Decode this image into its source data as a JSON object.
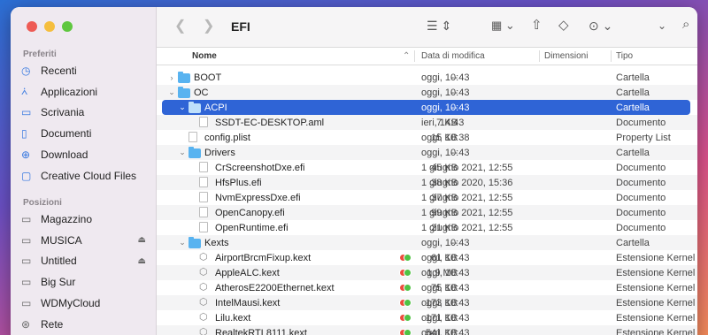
{
  "window": {
    "title": "EFI"
  },
  "traffic_lights": {
    "close": "#ee5b55",
    "minimize": "#f5be3e",
    "zoom": "#5fc73f"
  },
  "sidebar": {
    "favorites_title": "Preferiti",
    "favorites": [
      {
        "label": "Recenti",
        "icon": "clock-icon"
      },
      {
        "label": "Applicazioni",
        "icon": "apps-icon"
      },
      {
        "label": "Scrivania",
        "icon": "desktop-icon"
      },
      {
        "label": "Documenti",
        "icon": "document-icon"
      },
      {
        "label": "Download",
        "icon": "download-icon"
      },
      {
        "label": "Creative Cloud Files",
        "icon": "folder-icon"
      }
    ],
    "locations_title": "Posizioni",
    "locations": [
      {
        "label": "Magazzino",
        "icon": "drive-icon",
        "eject": false
      },
      {
        "label": "MUSICA",
        "icon": "drive-icon",
        "eject": true
      },
      {
        "label": "Untitled",
        "icon": "drive-icon",
        "eject": true
      },
      {
        "label": "Big Sur",
        "icon": "drive-icon",
        "eject": false
      },
      {
        "label": "WDMyCloud",
        "icon": "display-icon",
        "eject": false
      },
      {
        "label": "Rete",
        "icon": "globe-icon",
        "eject": false
      }
    ]
  },
  "toolbar": {
    "back_icon": "chevron-left-icon",
    "forward_icon": "chevron-right-icon",
    "list_view_icon": "list-view-icon",
    "group_icon": "grid-group-icon",
    "share_icon": "share-icon",
    "tag_icon": "tag-icon",
    "more_icon": "ellipsis-circle-icon",
    "search_icon": "search-icon"
  },
  "columns": {
    "name": "Nome",
    "date": "Data di modifica",
    "size": "Dimensioni",
    "kind": "Tipo"
  },
  "files": [
    {
      "name": "BOOT",
      "type": "folder",
      "level": 0,
      "open": false,
      "date": "oggi, 10:43",
      "size": "--",
      "kind": "Cartella"
    },
    {
      "name": "OC",
      "type": "folder",
      "level": 0,
      "open": true,
      "date": "oggi, 10:43",
      "size": "--",
      "kind": "Cartella"
    },
    {
      "name": "ACPI",
      "type": "folder",
      "level": 1,
      "open": true,
      "selected": true,
      "date": "oggi, 10:43",
      "size": "--",
      "kind": "Cartella"
    },
    {
      "name": "SSDT-EC-DESKTOP.aml",
      "type": "doc",
      "level": 2,
      "date": "ieri, 14:43",
      "size": "7 KB",
      "kind": "Documento"
    },
    {
      "name": "config.plist",
      "type": "doc",
      "level": 1,
      "date": "oggi, 10:38",
      "size": "15 KB",
      "kind": "Property List"
    },
    {
      "name": "Drivers",
      "type": "folder",
      "level": 1,
      "open": true,
      "date": "oggi, 10:43",
      "size": "--",
      "kind": "Cartella"
    },
    {
      "name": "CrScreenshotDxe.efi",
      "type": "doc",
      "level": 2,
      "date": "1 giugno 2021, 12:55",
      "size": "45 KB",
      "kind": "Documento"
    },
    {
      "name": "HfsPlus.efi",
      "type": "doc",
      "level": 2,
      "date": "1 giugno 2020, 15:36",
      "size": "38 KB",
      "kind": "Documento"
    },
    {
      "name": "NvmExpressDxe.efi",
      "type": "doc",
      "level": 2,
      "date": "1 giugno 2021, 12:55",
      "size": "37 KB",
      "kind": "Documento"
    },
    {
      "name": "OpenCanopy.efi",
      "type": "doc",
      "level": 2,
      "date": "1 giugno 2021, 12:55",
      "size": "99 KB",
      "kind": "Documento"
    },
    {
      "name": "OpenRuntime.efi",
      "type": "doc",
      "level": 2,
      "date": "1 giugno 2021, 12:55",
      "size": "21 KB",
      "kind": "Documento"
    },
    {
      "name": "Kexts",
      "type": "folder",
      "level": 1,
      "open": true,
      "date": "oggi, 10:43",
      "size": "--",
      "kind": "Cartella"
    },
    {
      "name": "AirportBrcmFixup.kext",
      "type": "kext",
      "level": 2,
      "tags": true,
      "date": "oggi, 10:43",
      "size": "61 KB",
      "kind": "Estensione Kernel"
    },
    {
      "name": "AppleALC.kext",
      "type": "kext",
      "level": 2,
      "tags": true,
      "date": "oggi, 10:43",
      "size": "1,9 MB",
      "kind": "Estensione Kernel"
    },
    {
      "name": "AtherosE2200Ethernet.kext",
      "type": "kext",
      "level": 2,
      "tags": true,
      "date": "oggi, 10:43",
      "size": "75 KB",
      "kind": "Estensione Kernel"
    },
    {
      "name": "IntelMausi.kext",
      "type": "kext",
      "level": 2,
      "tags": true,
      "date": "oggi, 10:43",
      "size": "173 KB",
      "kind": "Estensione Kernel"
    },
    {
      "name": "Lilu.kext",
      "type": "kext",
      "level": 2,
      "tags": true,
      "date": "oggi, 10:43",
      "size": "171 KB",
      "kind": "Estensione Kernel"
    },
    {
      "name": "RealtekRTL8111.kext",
      "type": "kext",
      "level": 2,
      "tags": true,
      "date": "oggi, 10:43",
      "size": "541 KB",
      "kind": "Estensione Kernel"
    }
  ],
  "tag_colors": {
    "red": "#ec4d3d",
    "green": "#4fc243"
  }
}
